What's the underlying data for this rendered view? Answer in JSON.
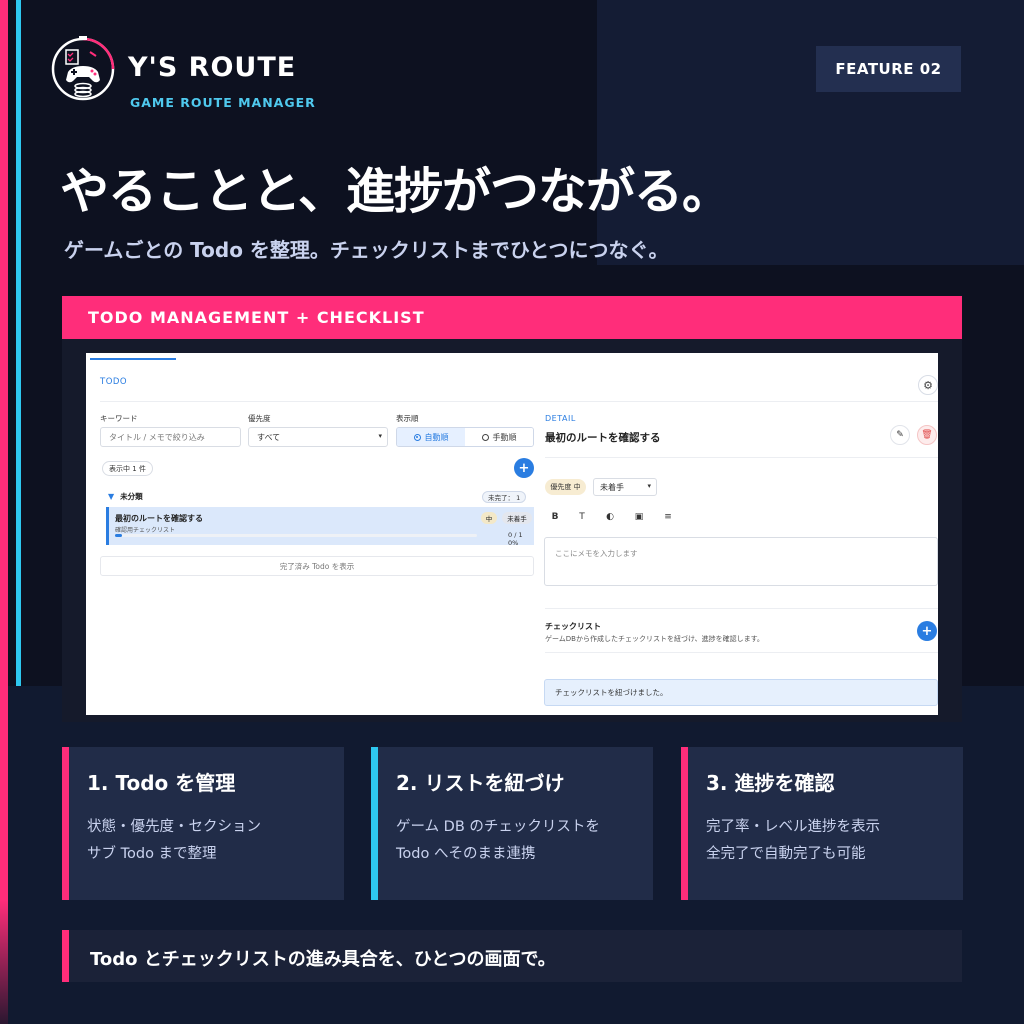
{
  "brand": {
    "title": "Y'S ROUTE",
    "subtitle": "GAME ROUTE MANAGER"
  },
  "feature_badge": "FEATURE 02",
  "headline": "やることと、進捗がつながる。",
  "subline": "ゲームごとの Todo を整理。チェックリストまでひとつにつなぐ。",
  "panel_title": "TODO MANAGEMENT + CHECKLIST",
  "app": {
    "tab_label": "TODO",
    "filters": {
      "keyword_label": "キーワード",
      "keyword_placeholder": "タイトル / メモで絞り込み",
      "priority_label": "優先度",
      "priority_value": "すべて",
      "order_label": "表示順",
      "order_auto": "自動順",
      "order_manual": "手動順"
    },
    "count_label": "表示中 1 件",
    "section_name": "未分類",
    "section_badge": "未完了： 1",
    "todo": {
      "title": "最初のルートを確認する",
      "subtitle": "確認用チェックリスト",
      "priority": "中",
      "status": "未着手",
      "progress_text": "0 / 1 0%",
      "progress": 0.02
    },
    "show_done": "完了済み Todo を表示",
    "detail": {
      "label": "DETAIL",
      "title": "最初のルートを確認する",
      "priority_pill": "優先度 中",
      "status_value": "未着手",
      "memo_placeholder": "ここにメモを入力します",
      "checklist_title": "チェックリスト",
      "checklist_desc": "ゲームDBから作成したチェックリストを紐づけ、進捗を確認します。",
      "toast": "チェックリストを紐づけました。"
    }
  },
  "cards": [
    {
      "title": "1. Todo を管理",
      "line1": "状態・優先度・セクション",
      "line2": "サブ Todo まで整理",
      "accent": "#ff2d7a"
    },
    {
      "title": "2. リストを紐づけ",
      "line1": "ゲーム DB のチェックリストを",
      "line2": "Todo へそのまま連携",
      "accent": "#2ec8f0"
    },
    {
      "title": "3. 進捗を確認",
      "line1": "完了率・レベル進捗を表示",
      "line2": "全完了で自動完了も可能",
      "accent": "#ff2d7a"
    }
  ],
  "bottom_text": "Todo とチェックリストの進み具合を、ひとつの画面で。",
  "colors": {
    "accent_pink": "#ff2d7a",
    "accent_cyan": "#2ec8f0",
    "app_blue": "#2a7de1",
    "background": "#0d1120"
  }
}
